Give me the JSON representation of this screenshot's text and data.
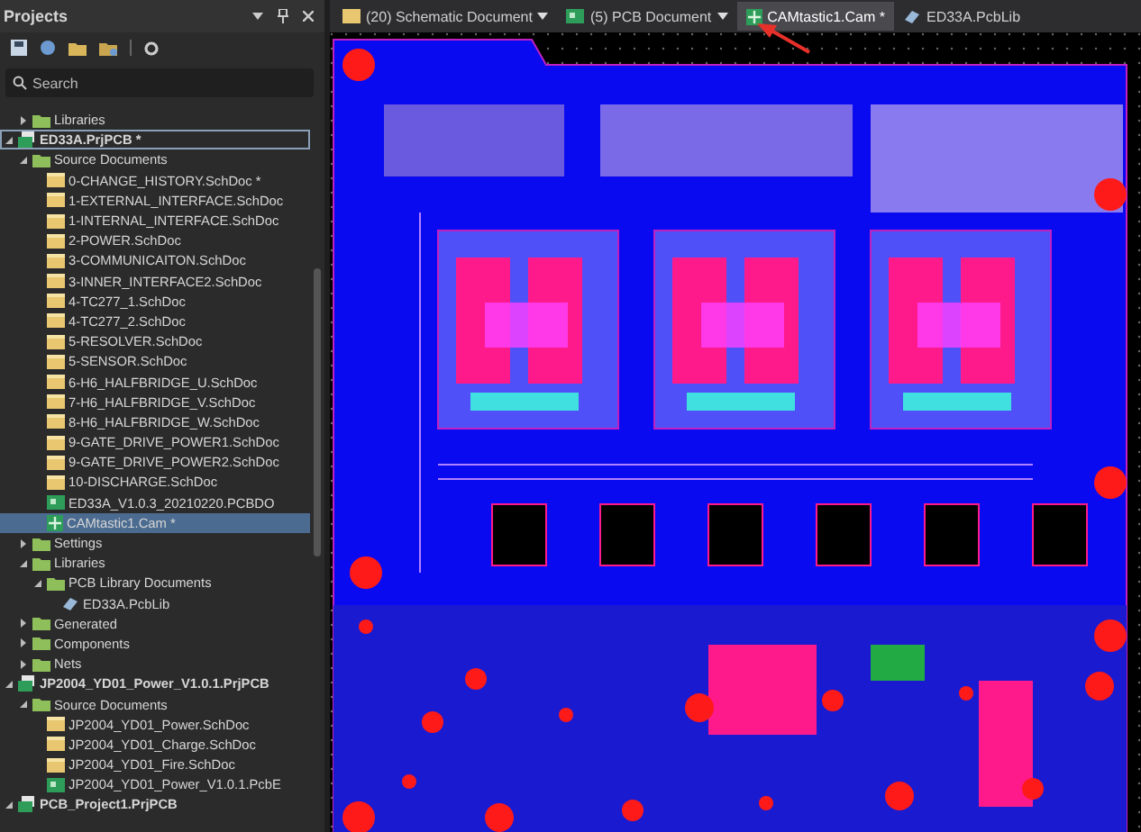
{
  "panel": {
    "title": "Projects",
    "search": {
      "placeholder": "Search"
    }
  },
  "tabs": [
    {
      "label": "(20) Schematic Document",
      "kind": "schematic",
      "dropdown": true,
      "selected": false
    },
    {
      "label": "(5) PCB Document",
      "kind": "pcb",
      "dropdown": true,
      "selected": false
    },
    {
      "label": "CAMtastic1.Cam *",
      "kind": "cam",
      "dropdown": false,
      "selected": true
    },
    {
      "label": "ED33A.PcbLib",
      "kind": "pcblib",
      "dropdown": false,
      "selected": false
    }
  ],
  "tree": [
    {
      "children": [
        {
          "label": "Libraries",
          "kind": "folder",
          "expanded": false,
          "selected": false
        }
      ]
    },
    {
      "label": "ED33A.PrjPCB *",
      "kind": "project",
      "expanded": true,
      "selected": false,
      "focused": true,
      "children": [
        {
          "label": "Source Documents",
          "kind": "folder",
          "expanded": true,
          "selected": false,
          "children": [
            {
              "label": "0-CHANGE_HISTORY.SchDoc *",
              "kind": "schdoc",
              "selected": false
            },
            {
              "label": "1-EXTERNAL_INTERFACE.SchDoc",
              "kind": "schdoc",
              "selected": false
            },
            {
              "label": "1-INTERNAL_INTERFACE.SchDoc",
              "kind": "schdoc",
              "selected": false
            },
            {
              "label": "2-POWER.SchDoc",
              "kind": "schdoc",
              "selected": false
            },
            {
              "label": "3-COMMUNICAITON.SchDoc",
              "kind": "schdoc",
              "selected": false
            },
            {
              "label": "3-INNER_INTERFACE2.SchDoc",
              "kind": "schdoc",
              "selected": false
            },
            {
              "label": "4-TC277_1.SchDoc",
              "kind": "schdoc",
              "selected": false
            },
            {
              "label": "4-TC277_2.SchDoc",
              "kind": "schdoc",
              "selected": false
            },
            {
              "label": "5-RESOLVER.SchDoc",
              "kind": "schdoc",
              "selected": false
            },
            {
              "label": "5-SENSOR.SchDoc",
              "kind": "schdoc",
              "selected": false
            },
            {
              "label": "6-H6_HALFBRIDGE_U.SchDoc",
              "kind": "schdoc",
              "selected": false
            },
            {
              "label": "7-H6_HALFBRIDGE_V.SchDoc",
              "kind": "schdoc",
              "selected": false
            },
            {
              "label": "8-H6_HALFBRIDGE_W.SchDoc",
              "kind": "schdoc",
              "selected": false
            },
            {
              "label": "9-GATE_DRIVE_POWER1.SchDoc",
              "kind": "schdoc",
              "selected": false
            },
            {
              "label": "9-GATE_DRIVE_POWER2.SchDoc",
              "kind": "schdoc",
              "selected": false
            },
            {
              "label": "10-DISCHARGE.SchDoc",
              "kind": "schdoc",
              "selected": false
            },
            {
              "label": "ED33A_V1.0.3_20210220.PCBDO",
              "kind": "pcbdoc",
              "selected": false
            },
            {
              "label": "CAMtastic1.Cam *",
              "kind": "cam",
              "selected": true
            }
          ]
        },
        {
          "label": "Settings",
          "kind": "folder",
          "expanded": false,
          "selected": false
        },
        {
          "label": "Libraries",
          "kind": "folder",
          "expanded": true,
          "selected": false,
          "children": [
            {
              "label": "PCB Library Documents",
              "kind": "folder",
              "expanded": true,
              "selected": false,
              "children": [
                {
                  "label": "ED33A.PcbLib",
                  "kind": "pcblib",
                  "selected": false
                }
              ]
            }
          ]
        },
        {
          "label": "Generated",
          "kind": "folder",
          "expanded": false,
          "selected": false
        },
        {
          "label": "Components",
          "kind": "folder",
          "expanded": false,
          "selected": false
        },
        {
          "label": "Nets",
          "kind": "folder",
          "expanded": false,
          "selected": false
        }
      ]
    },
    {
      "label": "JP2004_YD01_Power_V1.0.1.PrjPCB",
      "kind": "project",
      "expanded": true,
      "selected": false,
      "focused": false,
      "children": [
        {
          "label": "Source Documents",
          "kind": "folder",
          "expanded": true,
          "selected": false,
          "children": [
            {
              "label": "JP2004_YD01_Power.SchDoc",
              "kind": "schdoc",
              "selected": false
            },
            {
              "label": "JP2004_YD01_Charge.SchDoc",
              "kind": "schdoc",
              "selected": false
            },
            {
              "label": "JP2004_YD01_Fire.SchDoc",
              "kind": "schdoc",
              "selected": false
            },
            {
              "label": "JP2004_YD01_Power_V1.0.1.PcbE",
              "kind": "pcbdoc",
              "selected": false
            }
          ]
        }
      ]
    },
    {
      "label": "PCB_Project1.PrjPCB",
      "kind": "project",
      "expanded": true,
      "selected": false,
      "focused": false
    }
  ]
}
